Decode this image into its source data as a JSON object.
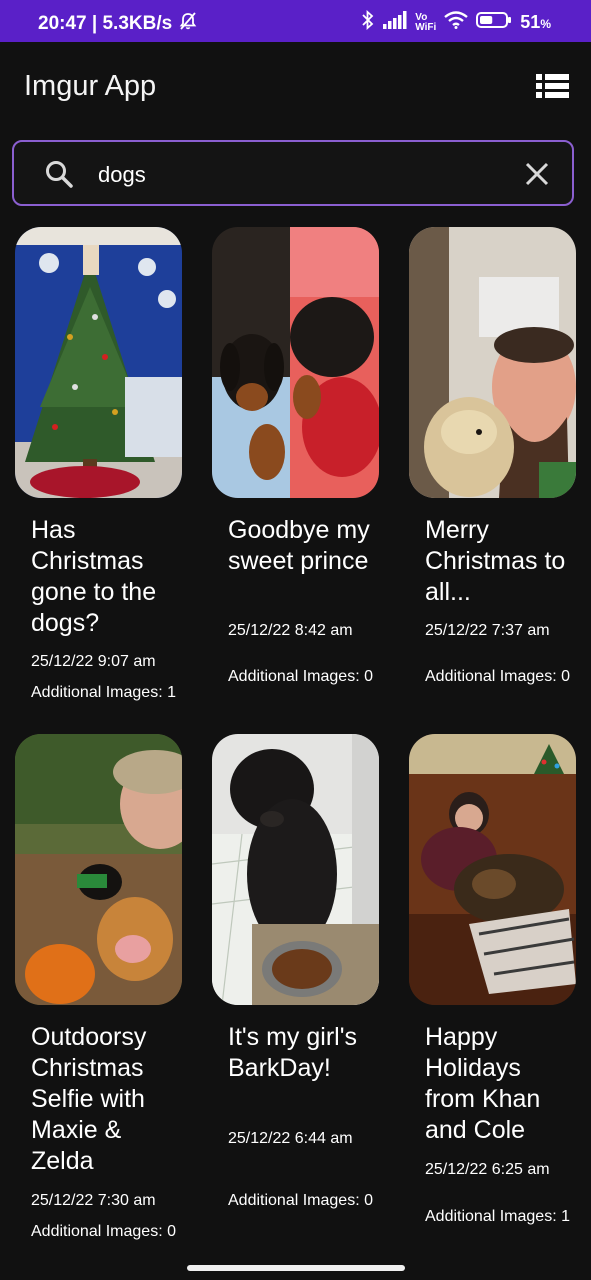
{
  "status_bar": {
    "time_speed": "20:47 | 5.3KB/s",
    "vowifi_top": "Vo",
    "vowifi_bottom": "WiFi",
    "battery": "51",
    "battery_unit": "%",
    "battery_level": 0.51
  },
  "app_bar": {
    "title": "Imgur App"
  },
  "search": {
    "value": "dogs"
  },
  "posts": [
    {
      "title": "Has Christmas gone to the dogs?",
      "date": "25/12/22 9:07 am",
      "additional": "Additional Images: 1"
    },
    {
      "title": "Goodbye my sweet prince",
      "date": "25/12/22 8:42 am",
      "additional": "Additional Images: 0"
    },
    {
      "title": "Merry Christmas to all...",
      "date": "25/12/22 7:37 am",
      "additional": "Additional Images: 0"
    },
    {
      "title": "Outdoorsy Christmas Selfie with Maxie & Zelda",
      "date": "25/12/22 7:30 am",
      "additional": "Additional Images: 0"
    },
    {
      "title": "It's my girl's BarkDay!",
      "date": "25/12/22 6:44 am",
      "additional": "Additional Images: 0"
    },
    {
      "title": "Happy Holidays from Khan and Cole",
      "date": "25/12/22 6:25 am",
      "additional": "Additional Images: 1"
    }
  ],
  "colors": {
    "status_bar": "#5a20c8",
    "background": "#111111",
    "search_border": "#8b5fd0"
  }
}
